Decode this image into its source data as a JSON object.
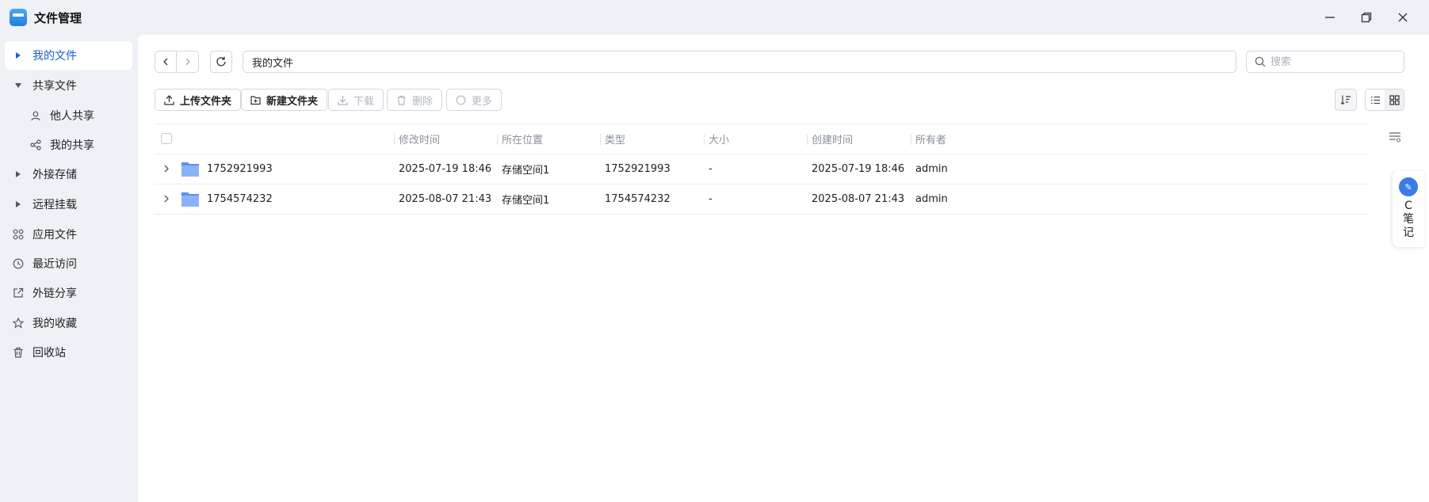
{
  "window": {
    "title": "文件管理"
  },
  "sidebar": {
    "items": [
      {
        "label": "我的文件"
      },
      {
        "label": "共享文件"
      },
      {
        "label": "他人共享"
      },
      {
        "label": "我的共享"
      },
      {
        "label": "外接存储"
      },
      {
        "label": "远程挂载"
      },
      {
        "label": "应用文件"
      },
      {
        "label": "最近访问"
      },
      {
        "label": "外链分享"
      },
      {
        "label": "我的收藏"
      },
      {
        "label": "回收站"
      }
    ]
  },
  "toolbar": {
    "path": "我的文件",
    "search_placeholder": "搜索",
    "upload_label": "上传文件夹",
    "new_folder_label": "新建文件夹",
    "download_label": "下载",
    "delete_label": "删除",
    "more_label": "更多"
  },
  "table": {
    "columns": {
      "modified": "修改时间",
      "location": "所在位置",
      "type": "类型",
      "size": "大小",
      "created": "创建时间",
      "owner": "所有者"
    },
    "rows": [
      {
        "name": "1752921993",
        "modified": "2025-07-19 18:46",
        "location": "存储空间1",
        "type": "1752921993",
        "size": "-",
        "created": "2025-07-19 18:46",
        "owner": "admin"
      },
      {
        "name": "1754574232",
        "modified": "2025-08-07 21:43",
        "location": "存储空间1",
        "type": "1754574232",
        "size": "-",
        "created": "2025-08-07 21:43",
        "owner": "admin"
      }
    ]
  },
  "float_note": {
    "logo_text": "C",
    "label": "笔记"
  },
  "colors": {
    "accent": "#1a5fd6",
    "sidebar_bg": "#eef1f6",
    "folder": "#7aa6f5"
  }
}
